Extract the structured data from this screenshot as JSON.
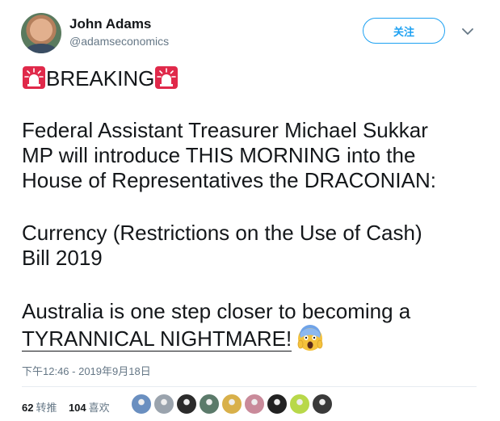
{
  "author": {
    "name": "John Adams",
    "handle": "@adamseconomics",
    "avatar_icon": "avatar-photo"
  },
  "follow_button": {
    "label": "关注"
  },
  "menu": {
    "icon": "chevron-down-icon"
  },
  "tweet": {
    "breaking_label": "BREAKING",
    "siren_icon": "police-siren-emoji",
    "lines": [
      "Federal Assistant Treasurer Michael Sukkar",
      "MP will introduce THIS MORNING into the",
      "House of Representatives the DRACONIAN:",
      "Currency (Restrictions on the Use of Cash)",
      "Bill 2019",
      "Australia is one step closer to becoming a"
    ],
    "last_line": "TYRANNICAL NIGHTMARE!",
    "last_emoji_icon": "screaming-face-emoji"
  },
  "timestamp": "下午12:46 - 2019年9月18日",
  "stats": {
    "retweets_count": "62",
    "retweets_label": "转推",
    "likes_count": "104",
    "likes_label": "喜欢"
  },
  "likers": [
    {
      "color": "#6a8fc0"
    },
    {
      "color": "#9aa3ad"
    },
    {
      "color": "#2b2b2b"
    },
    {
      "color": "#5b7a6a"
    },
    {
      "color": "#d8b04a"
    },
    {
      "color": "#c98a9a"
    },
    {
      "color": "#222222"
    },
    {
      "color": "#b8d84a"
    },
    {
      "color": "#3a3a3a"
    }
  ],
  "colors": {
    "accent": "#1da1f2",
    "muted": "#657786",
    "text": "#14171a"
  }
}
